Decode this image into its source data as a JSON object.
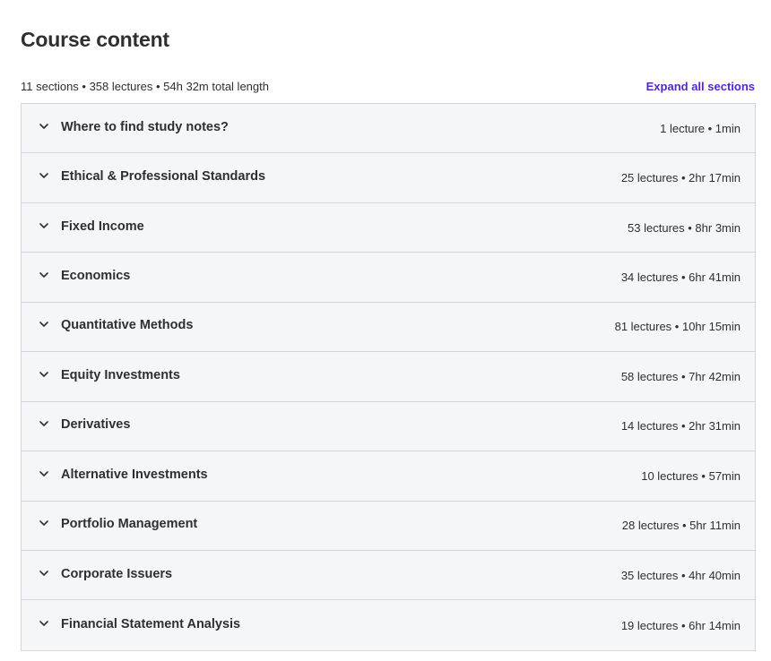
{
  "header": {
    "title": "Course content",
    "summary": "11 sections • 358 lectures • 54h 32m total length",
    "expand_label": "Expand all sections"
  },
  "colors": {
    "accent": "#5624d0",
    "text": "#2d2f31",
    "row_bg": "#f5f6f7",
    "border": "#d1d7dc"
  },
  "sections": [
    {
      "title": "Where to find study notes?",
      "meta": "1 lecture • 1min",
      "icon": "chevron-down-icon"
    },
    {
      "title": "Ethical & Professional Standards",
      "meta": "25 lectures • 2hr 17min",
      "icon": "chevron-down-icon"
    },
    {
      "title": "Fixed Income",
      "meta": "53 lectures • 8hr 3min",
      "icon": "chevron-down-icon"
    },
    {
      "title": "Economics",
      "meta": "34 lectures • 6hr 41min",
      "icon": "chevron-down-icon"
    },
    {
      "title": "Quantitative Methods",
      "meta": "81 lectures • 10hr 15min",
      "icon": "chevron-down-icon"
    },
    {
      "title": "Equity Investments",
      "meta": "58 lectures • 7hr 42min",
      "icon": "chevron-down-icon"
    },
    {
      "title": "Derivatives",
      "meta": "14 lectures • 2hr 31min",
      "icon": "chevron-down-icon"
    },
    {
      "title": "Alternative Investments",
      "meta": "10 lectures • 57min",
      "icon": "chevron-down-icon"
    },
    {
      "title": "Portfolio Management",
      "meta": "28 lectures • 5hr 11min",
      "icon": "chevron-down-icon"
    },
    {
      "title": "Corporate Issuers",
      "meta": "35 lectures • 4hr 40min",
      "icon": "chevron-down-icon"
    },
    {
      "title": "Financial Statement Analysis",
      "meta": "19 lectures • 6hr 14min",
      "icon": "chevron-down-icon"
    }
  ]
}
